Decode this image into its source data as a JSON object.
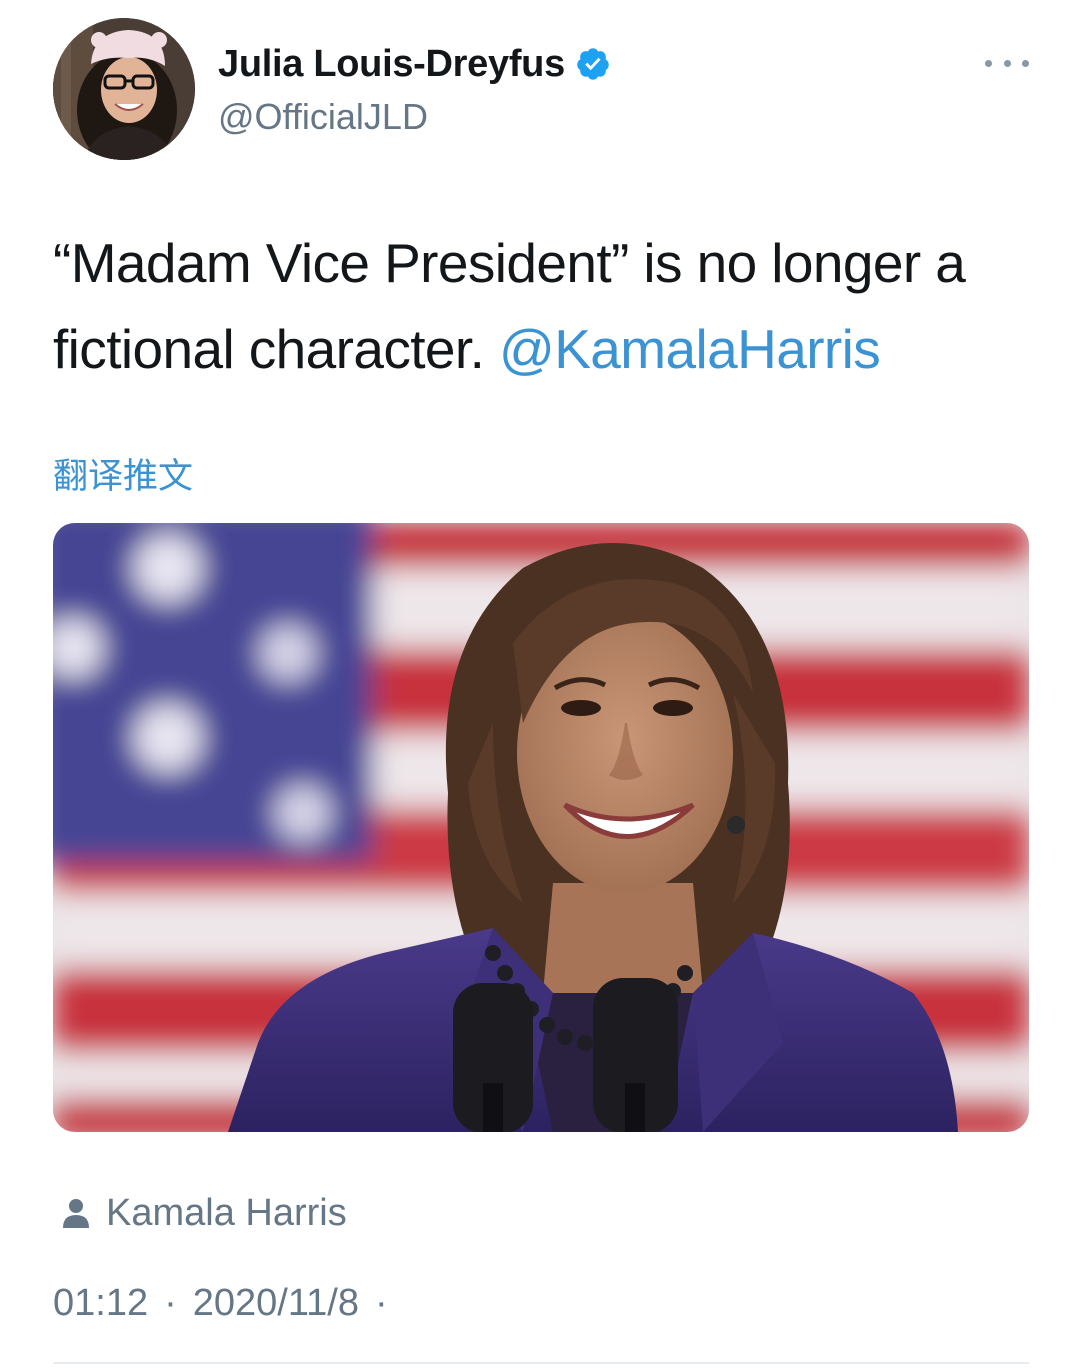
{
  "author": {
    "display_name": "Julia Louis-Dreyfus",
    "handle": "@OfficialJLD",
    "verified": true,
    "avatar_icon": "avatar-photo"
  },
  "more_icon": "ellipsis-icon",
  "tweet": {
    "text_before": "“Madam Vice President” is no longer a fictional character.",
    "mention": "@KamalaHarris"
  },
  "translate_label": "翻译推文",
  "media": {
    "alt": "photo"
  },
  "tagged_person": "Kamala Harris",
  "timestamp": {
    "time": "01:12",
    "separator": "·",
    "date": "2020/11/8",
    "trailing_separator": "·"
  },
  "colors": {
    "link": "#3b93d3",
    "secondary_text": "#657786",
    "verified_badge": "#1da1f2"
  }
}
